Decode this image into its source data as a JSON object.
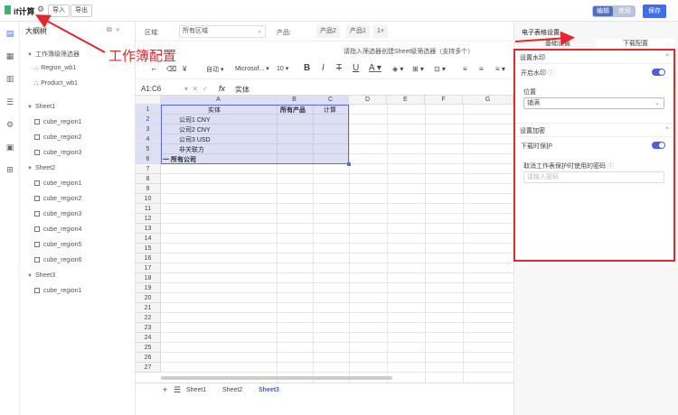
{
  "topbar": {
    "app_title": "if计算",
    "import_label": "导入",
    "export_label": "导出",
    "mode_edit": "编辑",
    "mode_use": "使用",
    "save_label": "保存"
  },
  "outline": {
    "title": "大纲树",
    "group_label": "工作簿级筛选器",
    "filters": [
      "Region_wb1",
      "Product_wb1"
    ],
    "sheets": [
      {
        "name": "Sheet1",
        "items": [
          "cube_region1",
          "cube_region2",
          "cube_region3"
        ]
      },
      {
        "name": "Sheet2",
        "items": [
          "cube_region1",
          "cube_region2",
          "cube_region3",
          "cube_region4",
          "cube_region5",
          "cube_region6"
        ]
      },
      {
        "name": "Sheet3",
        "items": [
          "cube_region1"
        ]
      }
    ]
  },
  "filterbar": {
    "region_label": "区域:",
    "region_value": "所有区域",
    "product_label": "产品:",
    "tabs": [
      "产品2",
      "产品1",
      "1+"
    ],
    "search_hint": "请指入筛选器创建Sheet级筛选器（支持多个）"
  },
  "toolbar": {
    "align_label": "自动",
    "font_label": "Microsof...",
    "font_size": "10"
  },
  "formulabar": {
    "cell_ref": "A1:C6",
    "value": "实体"
  },
  "grid": {
    "columns": [
      "A",
      "B",
      "C",
      "D",
      "E",
      "F",
      "G"
    ],
    "rows": [
      "1",
      "2",
      "3",
      "4",
      "5",
      "6",
      "7",
      "8",
      "9",
      "10",
      "11",
      "12",
      "13",
      "14",
      "15",
      "16",
      "17",
      "18",
      "19",
      "20",
      "21",
      "22",
      "23",
      "24",
      "25",
      "26",
      "27"
    ],
    "header_row": [
      "实体",
      "所有产品",
      "计算"
    ],
    "entity_rows": [
      "公司1 CNY",
      "公司2 CNY",
      "公司3 USD",
      "非关联方"
    ],
    "total_row": "一 所有公司"
  },
  "sheets": {
    "tabs": [
      "Sheet1",
      "Sheet2",
      "Sheet3"
    ],
    "active": "Sheet3"
  },
  "rightpanel": {
    "title": "电子表格设置",
    "tab_base": "基础设置",
    "tab_download": "下载配置",
    "watermark_section": "设置水印",
    "watermark_toggle_label": "开启水印",
    "position_label": "位置",
    "position_value": "铺满",
    "encrypt_section": "设置加密",
    "download_protect_label": "下载时保护",
    "password_label": "取消工作表保护时使用的密码",
    "password_placeholder": "请输入密码"
  },
  "annotation": {
    "text": "工作簿配置"
  },
  "colors": {
    "accent": "#3d6ef0",
    "highlight": "#e0282e",
    "toggle": "#4e5fd9"
  }
}
